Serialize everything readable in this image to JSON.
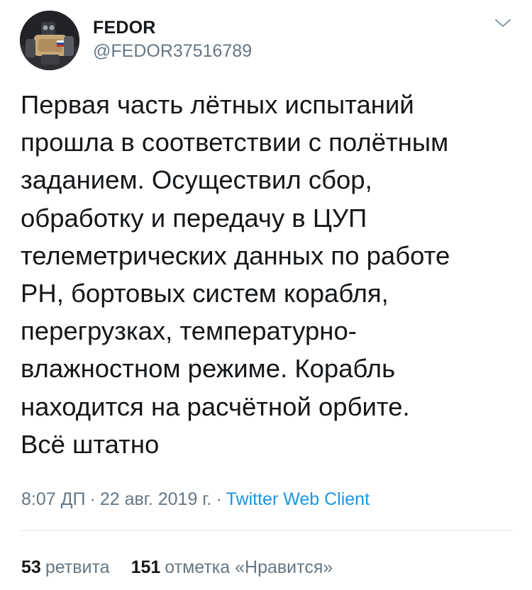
{
  "author": {
    "display_name": "FEDOR",
    "handle": "@FEDOR37516789"
  },
  "tweet": {
    "text": "Первая часть лётных испытаний\nпрошла в соответствии с полётным\nзаданием. Осуществил сбор,\nобработку и передачу в ЦУП\nтелеметрических данных по работе\nРН, бортовых систем корабля,\nперегрузках, температурно-\nвлажностном режиме. Корабль\nнаходится на расчётной орбите.\nВсё штатно",
    "time": "8:07 ДП",
    "separator1": "·",
    "date": "22 авг. 2019 г.",
    "separator2": "·",
    "client": "Twitter Web Client"
  },
  "stats": {
    "retweets_count": "53",
    "retweets_label": "ретвита",
    "likes_count": "151",
    "likes_label": "отметка «Нравится»"
  },
  "icons": {
    "menu": "chevron-down-icon"
  },
  "colors": {
    "text": "#14171a",
    "secondary": "#657786",
    "link": "#1b95e0",
    "divider": "#e1e8ed"
  }
}
